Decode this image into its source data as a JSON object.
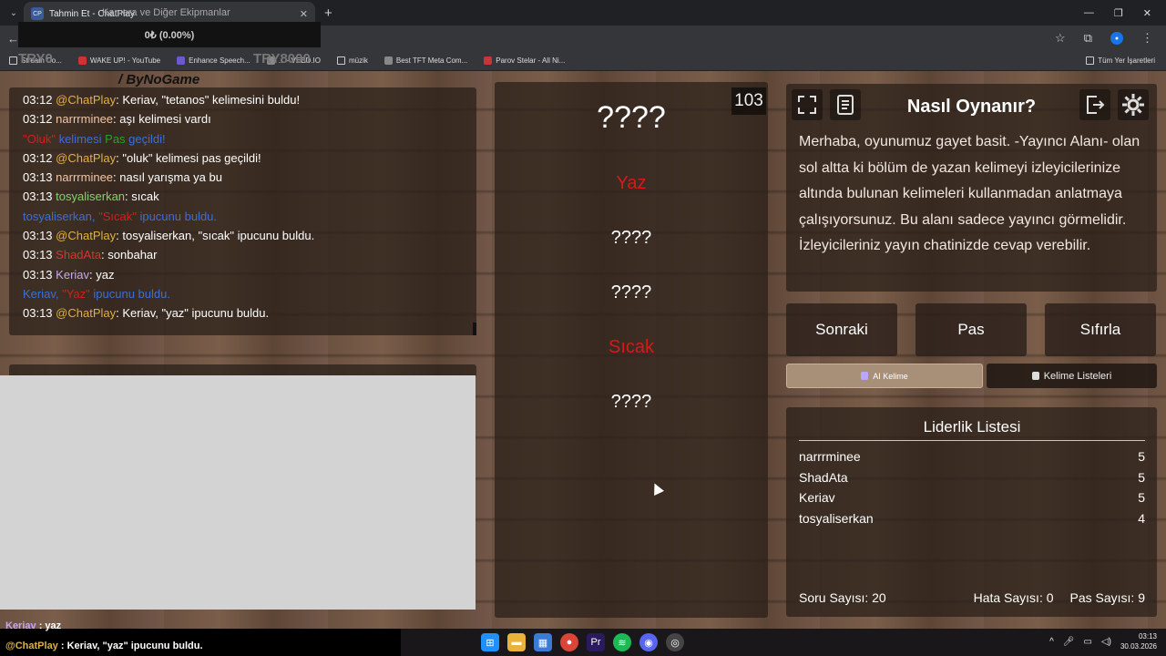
{
  "browser": {
    "tab_title": "Tahmin Et - ChatPlay",
    "tab_icon_text": "CP",
    "bookmarks": [
      {
        "label": "Stream Co...",
        "icon": "folder"
      },
      {
        "label": "WAKE UP! - YouTube",
        "icon": "youtube"
      },
      {
        "label": "Enhance Speech...",
        "icon": "purple"
      },
      {
        "label": "... - VEED.IO",
        "icon": "dark"
      },
      {
        "label": "müzik",
        "icon": "folder"
      },
      {
        "label": "Best TFT Meta Com...",
        "icon": "dark"
      },
      {
        "label": "Parov Stelar - All Ni...",
        "icon": "youtube"
      }
    ],
    "bookmarks_all": "Tüm Yer İşaretleri"
  },
  "overlay": {
    "balance": "0₺ (0.00%)",
    "camera_text": "Kamera ve Diğer Ekipmanlar",
    "left_tag": "TRY0",
    "mid_tag": "TRY8000",
    "brand": "/ ByNoGame"
  },
  "chat": [
    {
      "time": "03:12",
      "user": "@ChatPlay",
      "ucls": "u-chatplay",
      "msg": "Keriav, \"tetanos\" kelimesini buldu!"
    },
    {
      "time": "03:12",
      "user": "narrrminee",
      "ucls": "u-narr",
      "msg": "aşı kelimesi vardı"
    },
    {
      "sys": [
        "\"Oluk\"",
        " kelimesi ",
        "Pas",
        " geçildi!"
      ],
      "scls": [
        "sys-red",
        "sys",
        "sys-green",
        "sys"
      ]
    },
    {
      "time": "03:12",
      "user": "@ChatPlay",
      "ucls": "u-chatplay",
      "msg": "\"oluk\" kelimesi pas geçildi!"
    },
    {
      "time": "03:13",
      "user": "narrrminee",
      "ucls": "u-narr",
      "msg": "nasıl yarışma ya bu"
    },
    {
      "time": "03:13",
      "user": "tosyaliserkan",
      "ucls": "u-tosya",
      "msg": "sıcak"
    },
    {
      "sys": [
        "tosyaliserkan, ",
        "\"Sıcak\"",
        " ipucunu buldu."
      ],
      "scls": [
        "sys",
        "sys-red",
        "sys"
      ]
    },
    {
      "time": "03:13",
      "user": "@ChatPlay",
      "ucls": "u-chatplay",
      "msg": "tosyaliserkan, \"sıcak\" ipucunu buldu."
    },
    {
      "time": "03:13",
      "user": "ShadAta",
      "ucls": "u-shad",
      "msg": "sonbahar"
    },
    {
      "time": "03:13",
      "user": "Keriav",
      "ucls": "u-keriav",
      "msg": "yaz"
    },
    {
      "sys": [
        "Keriav, ",
        "\"Yaz\"",
        " ipucunu buldu."
      ],
      "scls": [
        "sys",
        "sys-red",
        "sys"
      ]
    },
    {
      "time": "03:13",
      "user": "@ChatPlay",
      "ucls": "u-chatplay",
      "msg": "Keriav, \"yaz\" ipucunu buldu."
    }
  ],
  "game": {
    "counter": "103",
    "secret_word": "????",
    "clues": [
      "Yaz",
      "????",
      "????",
      "Sıcak",
      "????"
    ]
  },
  "howto": {
    "title": "Nasıl Oynanır?",
    "text": "Merhaba, oyunumuz gayet basit. -Yayıncı Alanı- olan sol altta ki bölüm de yazan kelimeyi izleyicilerinize altında bulunan kelimeleri kullanmadan anlatmaya çalışıyorsunuz. Bu alanı sadece yayıncı görmelidir. İzleyicileriniz yayın chatinizde cevap verebilir."
  },
  "controls": {
    "next": "Sonraki",
    "pass": "Pas",
    "reset": "Sıfırla",
    "ai_tab": "AI Kelime",
    "lists_tab": "Kelime Listeleri"
  },
  "leaderboard": {
    "title": "Liderlik Listesi",
    "rows": [
      {
        "name": "narrrminee",
        "score": "5"
      },
      {
        "name": "ShadAta",
        "score": "5"
      },
      {
        "name": "Keriav",
        "score": "5"
      },
      {
        "name": "tosyaliserkan",
        "score": "4"
      }
    ],
    "questions_label": "Soru Sayısı: 20",
    "errors_label": "Hata Sayısı: 0",
    "passes_label": "Pas Sayısı: 9"
  },
  "stream_chat": {
    "line1_user": "Keriav",
    "line1_msg": " : yaz",
    "line2_user": "@ChatPlay",
    "line2_msg": " : Keriav, \"yaz\" ipucunu buldu."
  },
  "taskbar": {
    "time": "03:13",
    "date": "30.03.2026"
  },
  "colors": {
    "accent_red": "#d61a1a",
    "system_blue": "#3b6fd6",
    "active_tab": "#a89078"
  }
}
